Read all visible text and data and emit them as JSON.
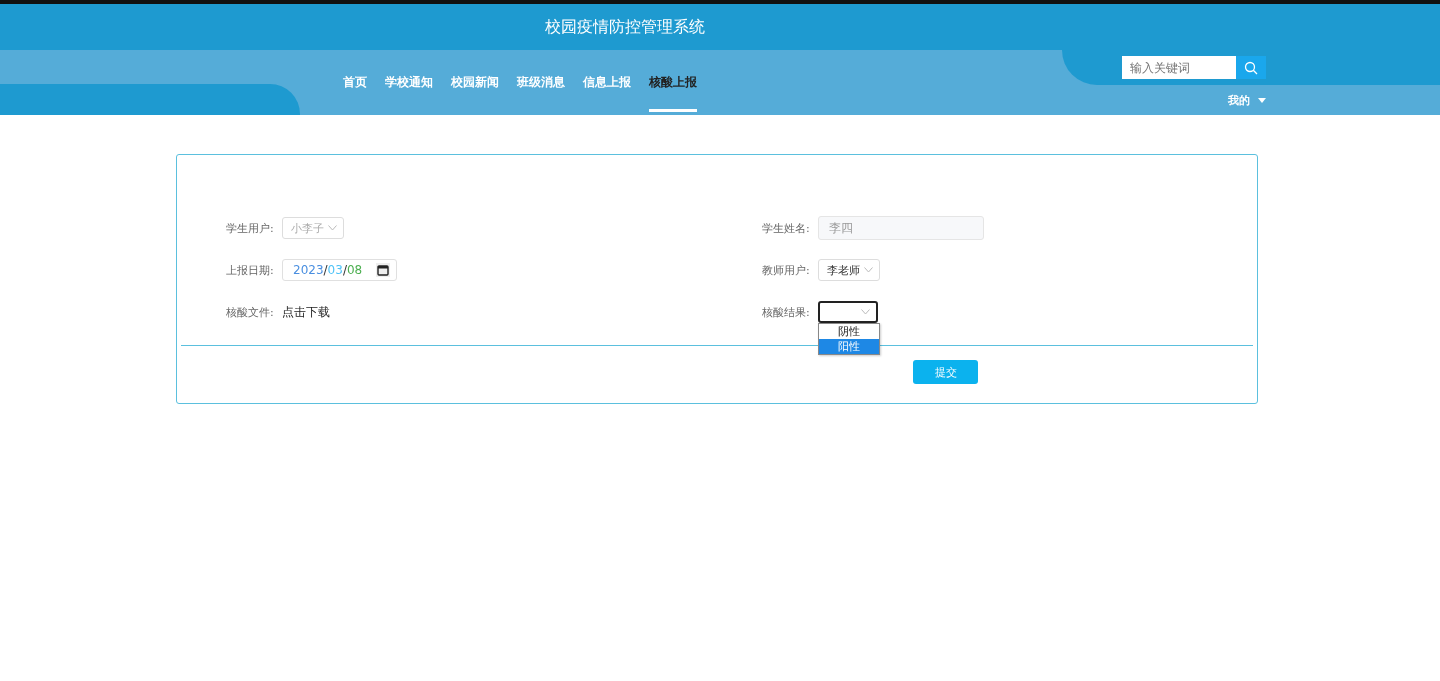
{
  "header": {
    "title": "校园疫情防控管理系统",
    "nav": [
      {
        "label": "首页",
        "selected": false
      },
      {
        "label": "学校通知",
        "selected": false
      },
      {
        "label": "校园新闻",
        "selected": false
      },
      {
        "label": "班级消息",
        "selected": false
      },
      {
        "label": "信息上报",
        "selected": false
      },
      {
        "label": "核酸上报",
        "selected": true
      }
    ],
    "search": {
      "placeholder": "输入关键词"
    },
    "user_menu": "我的"
  },
  "form": {
    "fields": [
      {
        "label": "学生用户:",
        "kind": "select",
        "value": "小李子",
        "disabled": true
      },
      {
        "label": "学生姓名:",
        "kind": "text",
        "value": "李四",
        "disabled": true
      },
      {
        "label": "上报日期:",
        "kind": "date",
        "value": "2023/03/08"
      },
      {
        "label": "教师用户:",
        "kind": "select",
        "value": "李老师",
        "disabled": false
      },
      {
        "label": "核酸文件:",
        "kind": "link",
        "value": "点击下载"
      },
      {
        "label": "核酸结果:",
        "kind": "select",
        "disabled": false,
        "expanded": true,
        "options": [
          {
            "label": "阴性",
            "selected": false
          },
          {
            "label": "阳性",
            "selected": true
          }
        ]
      }
    ],
    "submit": "提交"
  }
}
